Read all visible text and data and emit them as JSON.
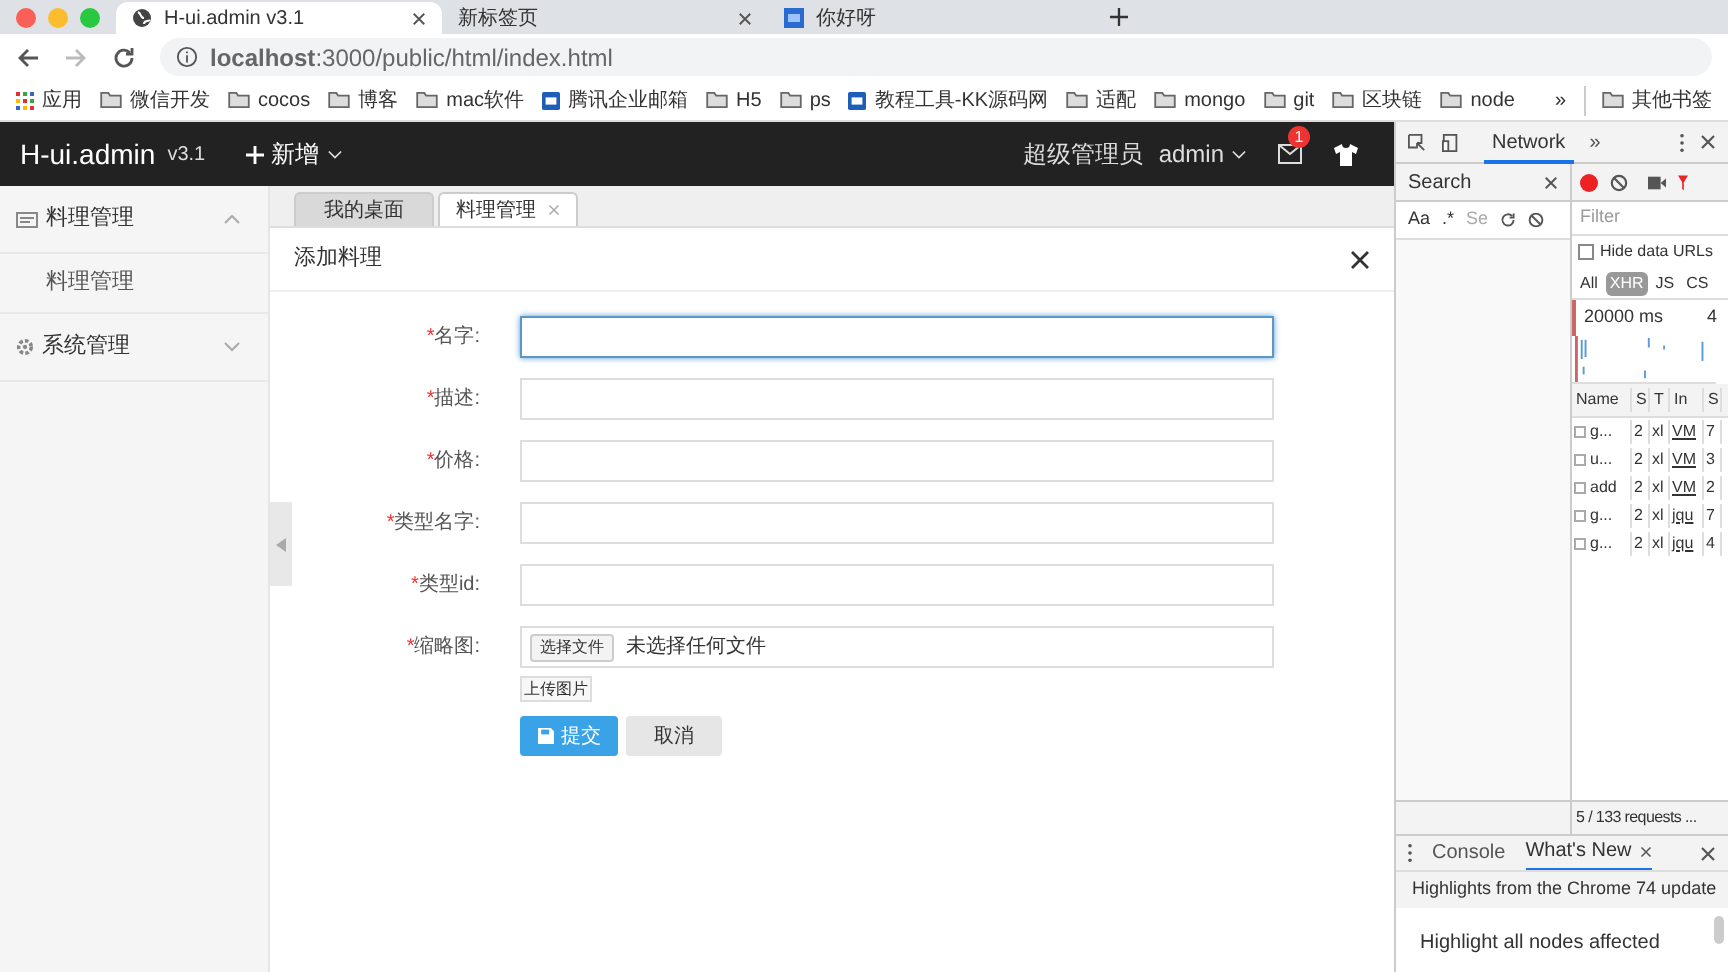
{
  "browser": {
    "tabs": [
      {
        "title": "H-ui.admin v3.1",
        "selected": true,
        "kind": "globe"
      },
      {
        "title": "新标签页",
        "selected": false,
        "kind": "plain"
      },
      {
        "title": "你好呀",
        "selected": false,
        "kind": "api"
      }
    ],
    "address": "**localhost**:3000/public/html/index.html",
    "bookmarks": [
      {
        "label": "应用",
        "kind": "apps"
      },
      {
        "label": "微信开发",
        "kind": "folder"
      },
      {
        "label": "cocos",
        "kind": "folder"
      },
      {
        "label": "博客",
        "kind": "folder"
      },
      {
        "label": "mac软件",
        "kind": "folder"
      },
      {
        "label": "腾讯企业邮箱",
        "kind": "site"
      },
      {
        "label": "H5",
        "kind": "folder"
      },
      {
        "label": "ps",
        "kind": "folder"
      },
      {
        "label": "教程工具-KK源码网",
        "kind": "site"
      },
      {
        "label": "适配",
        "kind": "folder"
      },
      {
        "label": "mongo",
        "kind": "folder"
      },
      {
        "label": "git",
        "kind": "folder"
      },
      {
        "label": "区块链",
        "kind": "folder"
      },
      {
        "label": "node",
        "kind": "folder"
      }
    ],
    "bookmarks_more": "»",
    "other_bookmarks": "其他书签"
  },
  "app": {
    "brand": "H-ui.admin",
    "version": "v3.1",
    "add_menu": "新增",
    "user_role": "超级管理员",
    "user_name": "admin",
    "message_count": "1"
  },
  "sidebar": [
    {
      "label": "料理管理",
      "kind": "list",
      "expanded": true,
      "children": [
        {
          "label": "料理管理"
        }
      ]
    },
    {
      "label": "系统管理",
      "kind": "gear",
      "expanded": false
    }
  ],
  "page_tabs": [
    {
      "label": "我的桌面",
      "selected": false,
      "closable": false
    },
    {
      "label": "料理管理",
      "selected": true,
      "closable": true
    }
  ],
  "dialog": {
    "title": "添加料理",
    "fields": [
      {
        "mark": "*",
        "label": "名字:",
        "kind": "text",
        "focused": true
      },
      {
        "mark": "*",
        "label": "描述:",
        "kind": "text",
        "focused": false
      },
      {
        "mark": "*",
        "label": "价格:",
        "kind": "text",
        "focused": false
      },
      {
        "mark": "*",
        "label": "类型名字:",
        "kind": "text",
        "focused": false
      },
      {
        "mark": "*",
        "label": "类型id:",
        "kind": "text",
        "focused": false
      },
      {
        "mark": "*",
        "label": "缩略图:",
        "kind": "file",
        "focused": false
      }
    ],
    "file_button": "选择文件",
    "file_status": "未选择任何文件",
    "upload_button": "上传图片",
    "submit": "提交",
    "cancel": "取消"
  },
  "devtools": {
    "panel": "Network",
    "more": "»",
    "search_title": "Search",
    "search_options": [
      "Aa",
      ".*",
      "Se"
    ],
    "filter_placeholder": "Filter",
    "hide_data_urls": "Hide data URLs",
    "hide_data_urls_checked": false,
    "types": [
      {
        "label": "All",
        "selected": false
      },
      {
        "label": "XHR",
        "selected": true
      },
      {
        "label": "JS",
        "selected": false
      },
      {
        "label": "CS",
        "selected": false
      }
    ],
    "timeline_ticks": [
      "20000 ms",
      "4"
    ],
    "columns": [
      "Name",
      "S",
      "T",
      "In",
      "S"
    ],
    "rows": [
      [
        "g...",
        "2",
        "xl",
        "VM",
        "7"
      ],
      [
        "u...",
        "2",
        "xl",
        "VM",
        "3"
      ],
      [
        "add",
        "2",
        "xl",
        "VM",
        "2"
      ],
      [
        "g...",
        "2",
        "xl",
        "jqu",
        "7"
      ],
      [
        "g...",
        "2",
        "xl",
        "jqu",
        "4"
      ]
    ],
    "summary": "5 / 133 requests ...",
    "drawer_tabs": [
      {
        "label": "Console",
        "selected": false
      },
      {
        "label": "What's New",
        "selected": true
      }
    ],
    "drawer_heading": "Highlights from the Chrome 74 update",
    "drawer_text": "Highlight all nodes affected"
  }
}
